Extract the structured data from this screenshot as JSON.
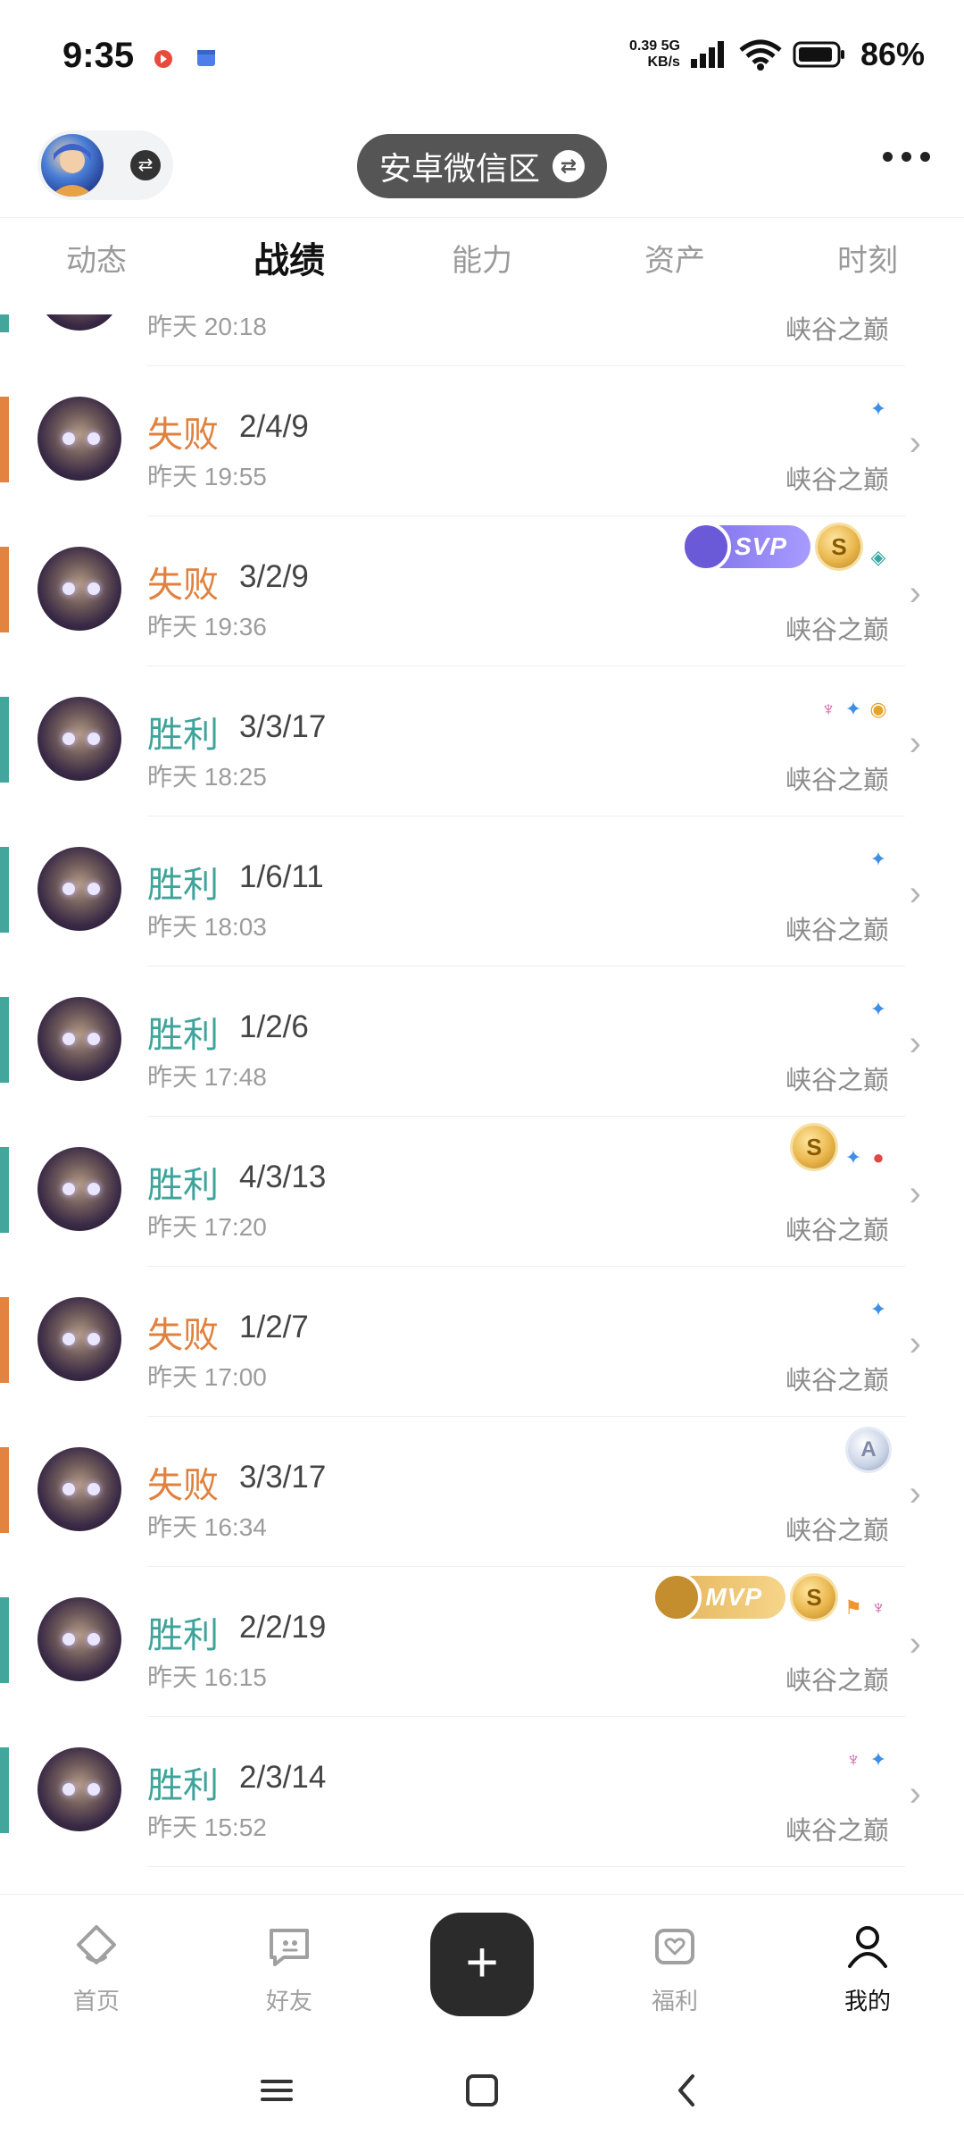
{
  "status_bar": {
    "time": "9:35",
    "net_speed_value": "0.39",
    "net_speed_unit": "KB/s",
    "net_type": "5G",
    "battery": "86%"
  },
  "header": {
    "zone_label": "安卓微信区"
  },
  "tabs": [
    "动态",
    "战绩",
    "能力",
    "资产",
    "时刻"
  ],
  "active_tab": "战绩",
  "matches": [
    {
      "result": "",
      "kda": "",
      "time": "昨天 20:18",
      "mode": "峡谷之巅",
      "outcome": "win"
    },
    {
      "result": "失败",
      "kda": "2/4/9",
      "time": "昨天 19:55",
      "mode": "峡谷之巅",
      "outcome": "lose"
    },
    {
      "result": "失败",
      "kda": "3/2/9",
      "time": "昨天 19:36",
      "mode": "峡谷之巅",
      "outcome": "lose",
      "badge": "SVP",
      "coin": "S"
    },
    {
      "result": "胜利",
      "kda": "3/3/17",
      "time": "昨天 18:25",
      "mode": "峡谷之巅",
      "outcome": "win"
    },
    {
      "result": "胜利",
      "kda": "1/6/11",
      "time": "昨天 18:03",
      "mode": "峡谷之巅",
      "outcome": "win"
    },
    {
      "result": "胜利",
      "kda": "1/2/6",
      "time": "昨天 17:48",
      "mode": "峡谷之巅",
      "outcome": "win"
    },
    {
      "result": "胜利",
      "kda": "4/3/13",
      "time": "昨天 17:20",
      "mode": "峡谷之巅",
      "outcome": "win",
      "coin": "S"
    },
    {
      "result": "失败",
      "kda": "1/2/7",
      "time": "昨天 17:00",
      "mode": "峡谷之巅",
      "outcome": "lose"
    },
    {
      "result": "失败",
      "kda": "3/3/17",
      "time": "昨天 16:34",
      "mode": "峡谷之巅",
      "outcome": "lose",
      "coin": "A"
    },
    {
      "result": "胜利",
      "kda": "2/2/19",
      "time": "昨天 16:15",
      "mode": "峡谷之巅",
      "outcome": "win",
      "badge": "MVP",
      "coin": "S"
    },
    {
      "result": "胜利",
      "kda": "2/3/14",
      "time": "昨天 15:52",
      "mode": "峡谷之巅",
      "outcome": "win"
    }
  ],
  "bottom_nav": {
    "home": "首页",
    "friends": "好友",
    "add": "+",
    "welfare": "福利",
    "mine": "我的"
  },
  "colors": {
    "win": "#3ea39a",
    "lose": "#e0813e",
    "svp": "#8b7cf0",
    "mvp": "#e8b65c"
  }
}
